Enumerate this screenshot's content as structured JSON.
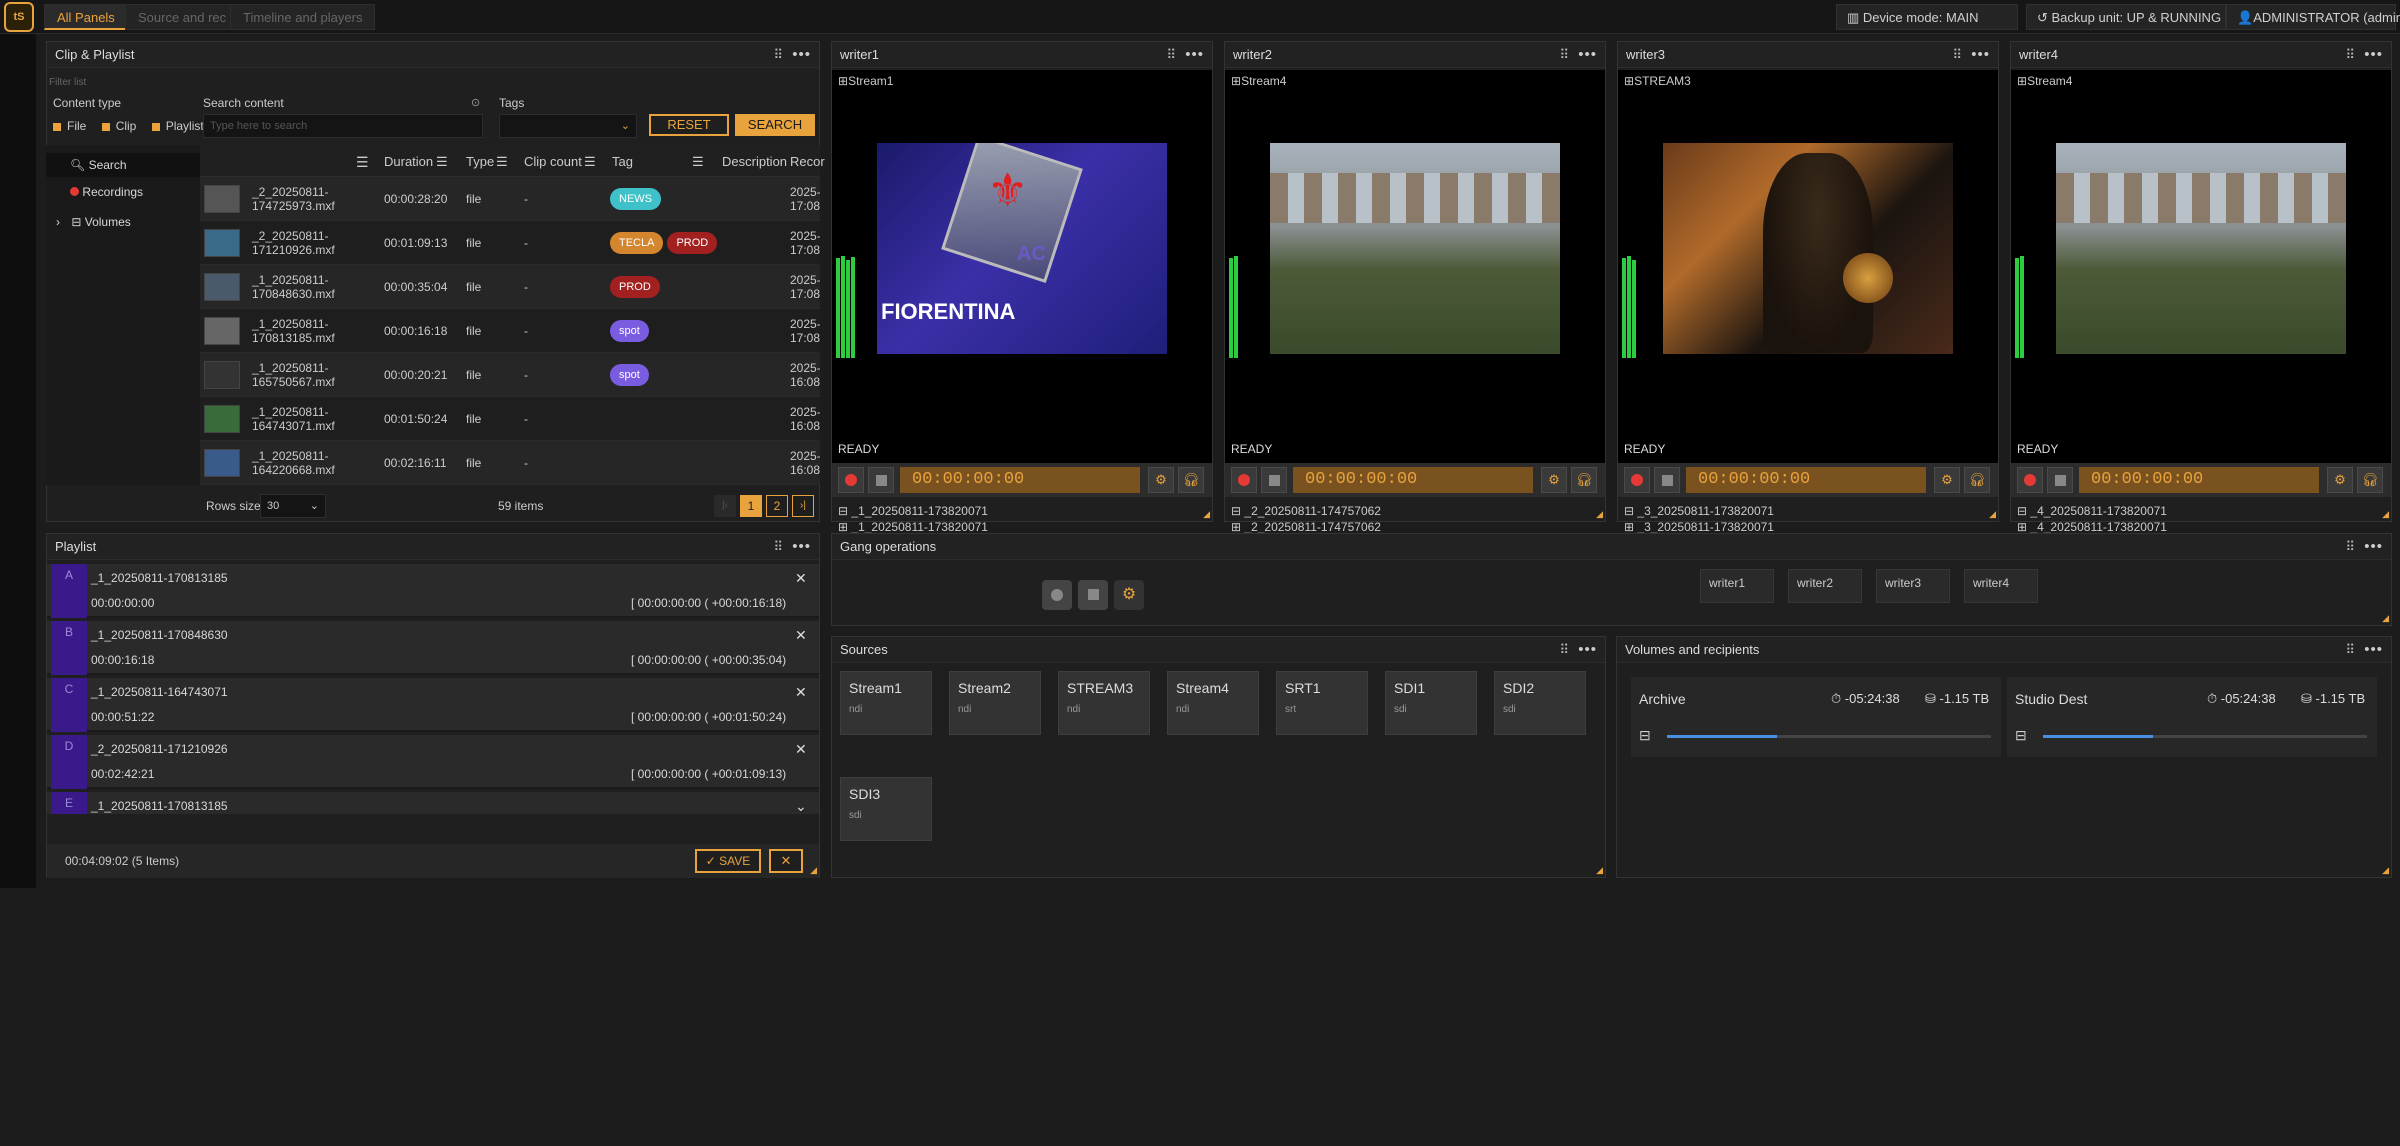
{
  "topbar": {
    "logo": "tS",
    "tabs": [
      "All Panels",
      "Source and rec",
      "Timeline and players"
    ],
    "device_mode": "Device mode: MAIN",
    "backup_unit": "Backup unit: UP & RUNNING",
    "user": "ADMINISTRATOR (admins)"
  },
  "clip_panel": {
    "title": "Clip & Playlist",
    "filter_label": "Filter list",
    "content_type_label": "Content type",
    "content_types": [
      "File",
      "Clip",
      "Playlist"
    ],
    "search_content_label": "Search content",
    "search_placeholder": "Type here to search",
    "tags_label": "Tags",
    "reset_label": "RESET",
    "search_label": "SEARCH",
    "nav": {
      "search": "Search",
      "recordings": "Recordings",
      "volumes": "Volumes"
    },
    "columns": [
      "Duration",
      "Type",
      "Clip count",
      "Tag",
      "Description",
      "Recor"
    ],
    "rows": [
      {
        "name": "_2_20250811-174725973.mxf",
        "duration": "00:00:28:20",
        "type": "file",
        "clips": "-",
        "tags": [
          {
            "t": "NEWS",
            "c": "#3fc1c9"
          }
        ],
        "rec": "2025-",
        "rec2": "17:08"
      },
      {
        "name": "_2_20250811-171210926.mxf",
        "duration": "00:01:09:13",
        "type": "file",
        "clips": "-",
        "tags": [
          {
            "t": "TECLA",
            "c": "#d4862e"
          },
          {
            "t": "PROD",
            "c": "#a32020"
          }
        ],
        "rec": "2025-",
        "rec2": "17:08"
      },
      {
        "name": "_1_20250811-170848630.mxf",
        "duration": "00:00:35:04",
        "type": "file",
        "clips": "-",
        "tags": [
          {
            "t": "PROD",
            "c": "#a32020"
          }
        ],
        "rec": "2025-",
        "rec2": "17:08"
      },
      {
        "name": "_1_20250811-170813185.mxf",
        "duration": "00:00:16:18",
        "type": "file",
        "clips": "-",
        "tags": [
          {
            "t": "spot",
            "c": "#7a5ce0"
          }
        ],
        "rec": "2025-",
        "rec2": "17:08"
      },
      {
        "name": "_1_20250811-165750567.mxf",
        "duration": "00:00:20:21",
        "type": "file",
        "clips": "-",
        "tags": [
          {
            "t": "spot",
            "c": "#7a5ce0"
          }
        ],
        "rec": "2025-",
        "rec2": "16:08"
      },
      {
        "name": "_1_20250811-164743071.mxf",
        "duration": "00:01:50:24",
        "type": "file",
        "clips": "-",
        "tags": [],
        "rec": "2025-",
        "rec2": "16:08"
      },
      {
        "name": "_1_20250811-164220668.mxf",
        "duration": "00:02:16:11",
        "type": "file",
        "clips": "-",
        "tags": [],
        "rec": "2025-",
        "rec2": "16:08"
      }
    ],
    "rows_size_label": "Rows size",
    "rows_size": "30",
    "items": "59 items",
    "pages": [
      "1",
      "2"
    ]
  },
  "writers": [
    {
      "title": "writer1",
      "stream": "Stream1",
      "state": "READY",
      "tc": "00:00:00:00",
      "file1": "_1_20250811-173820071",
      "file2": "_1_20250811-173820071"
    },
    {
      "title": "writer2",
      "stream": "Stream4",
      "state": "READY",
      "tc": "00:00:00:00",
      "file1": "_2_20250811-174757062",
      "file2": "_2_20250811-174757062"
    },
    {
      "title": "writer3",
      "stream": "STREAM3",
      "state": "READY",
      "tc": "00:00:00:00",
      "file1": "_3_20250811-173820071",
      "file2": "_3_20250811-173820071"
    },
    {
      "title": "writer4",
      "stream": "Stream4",
      "state": "READY",
      "tc": "00:00:00:00",
      "file1": "_4_20250811-173820071",
      "file2": "_4_20250811-173820071"
    }
  ],
  "video_text": {
    "fiorentina": "FIORENTINA",
    "ac": "AC"
  },
  "playlist": {
    "title": "Playlist",
    "items": [
      {
        "letter": "A",
        "name": "_1_20250811-170813185",
        "start": "00:00:00:00",
        "dur": "00:00:00:00 ( +00:00:16:18)"
      },
      {
        "letter": "B",
        "name": "_1_20250811-170848630",
        "start": "00:00:16:18",
        "dur": "00:00:00:00 ( +00:00:35:04)"
      },
      {
        "letter": "C",
        "name": "_1_20250811-164743071",
        "start": "00:00:51:22",
        "dur": "00:00:00:00 ( +00:01:50:24)"
      },
      {
        "letter": "D",
        "name": "_2_20250811-171210926",
        "start": "00:02:42:21",
        "dur": "00:00:00:00 ( +00:01:09:13)"
      },
      {
        "letter": "E",
        "name": "_1_20250811-170813185"
      }
    ],
    "total": "00:04:09:02 (5 Items)",
    "save_label": "SAVE"
  },
  "gang": {
    "title": "Gang operations",
    "writers": [
      "writer1",
      "writer2",
      "writer3",
      "writer4"
    ]
  },
  "sources": {
    "title": "Sources",
    "items": [
      {
        "name": "Stream1",
        "type": "ndi"
      },
      {
        "name": "Stream2",
        "type": "ndi"
      },
      {
        "name": "STREAM3",
        "type": "ndi"
      },
      {
        "name": "Stream4",
        "type": "ndi"
      },
      {
        "name": "SRT1",
        "type": "srt"
      },
      {
        "name": "SDI1",
        "type": "sdi"
      },
      {
        "name": "SDI2",
        "type": "sdi"
      },
      {
        "name": "SDI3",
        "type": "sdi"
      }
    ]
  },
  "volumes": {
    "title": "Volumes and recipients",
    "items": [
      {
        "name": "Archive",
        "time": "-05:24:38",
        "space": "-1.15 TB",
        "usage": 0.34
      },
      {
        "name": "Studio Dest",
        "time": "-05:24:38",
        "space": "-1.15 TB",
        "usage": 0.34
      }
    ]
  },
  "colors": {
    "accent": "#e8a33d",
    "rec": "#e53935",
    "ready_vu": "#2ecc40"
  }
}
